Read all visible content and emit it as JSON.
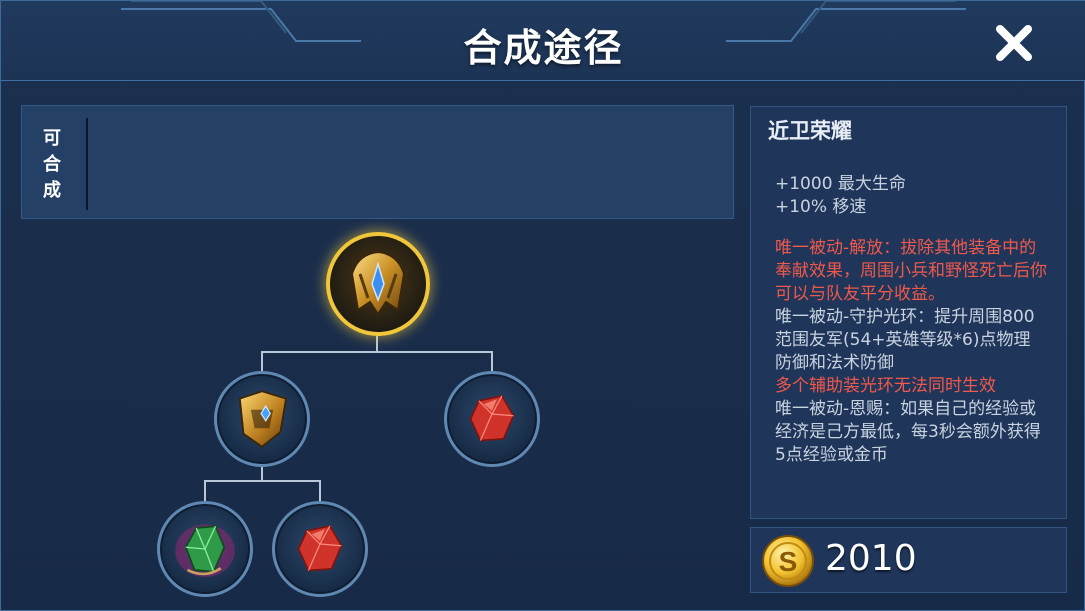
{
  "header": {
    "title": "合成途径",
    "close_icon": "close-icon"
  },
  "craftable": {
    "label": "可合成",
    "label_chars": [
      "可",
      "合",
      "成"
    ]
  },
  "tree": {
    "root": {
      "name": "近卫荣耀",
      "icon": "golden-helmet-icon",
      "selected": true
    },
    "children": [
      {
        "icon": "golden-shield-icon",
        "children": [
          {
            "icon": "green-gem-icon"
          },
          {
            "icon": "red-crystal-icon"
          }
        ]
      },
      {
        "icon": "red-crystal-icon"
      }
    ]
  },
  "item": {
    "name": "近卫荣耀",
    "stats": [
      "+1000 最大生命",
      "+10% 移速"
    ],
    "passives": [
      {
        "color": "#f0584a",
        "text": "唯一被动-解放：拔除其他装备中的奉献效果，周围小兵和野怪死亡后你可以与队友平分收益。"
      },
      {
        "color": "#c9d3e0",
        "text": "唯一被动-守护光环：提升周围800范围友军(54+英雄等级*6)点物理防御和法术防御"
      },
      {
        "color": "#f0584a",
        "text": "多个辅助装光环无法同时生效"
      },
      {
        "color": "#c9d3e0",
        "text": "唯一被动-恩赐：如果自己的经验或经济是己方最低，每3秒会额外获得5点经验或金币"
      }
    ],
    "price": "2010",
    "coin_icon": "gold-coin-icon"
  },
  "colors": {
    "accent_gold": "#f0c63a",
    "passive_red": "#f0584a",
    "panel_blue": "#1f365a"
  }
}
